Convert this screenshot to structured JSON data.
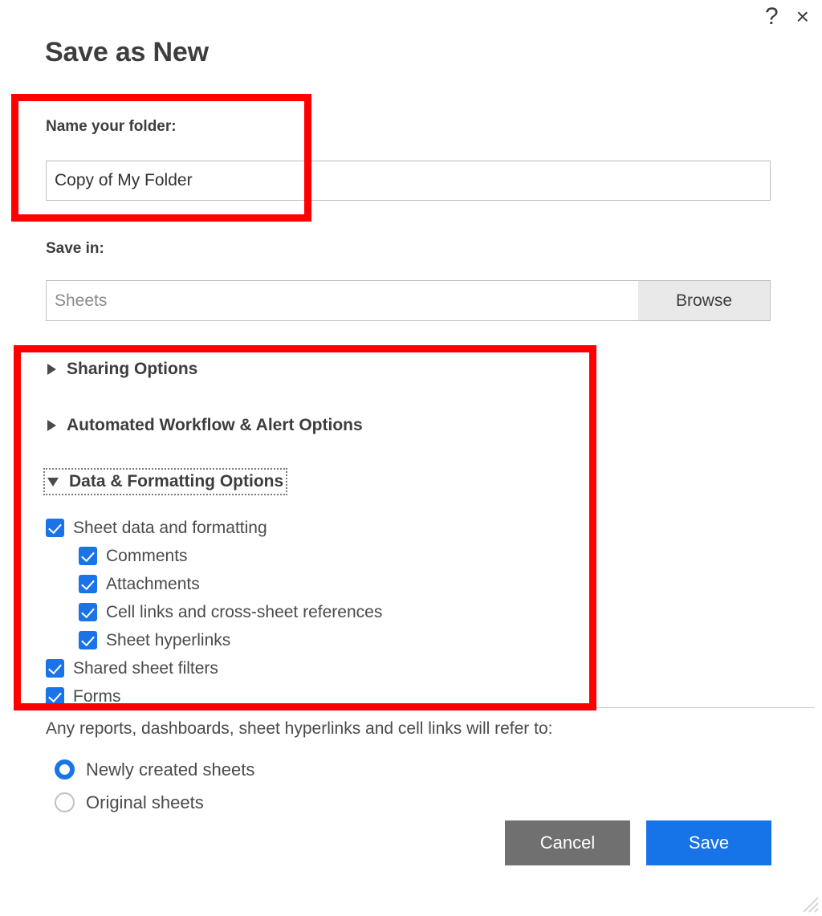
{
  "dialog": {
    "title": "Save as New",
    "help_icon": "?",
    "close_icon": "×"
  },
  "name_field": {
    "label": "Name your folder:",
    "value": "Copy of My Folder",
    "placeholder": ""
  },
  "save_in_field": {
    "label": "Save in:",
    "value": "",
    "placeholder": "Sheets",
    "browse_label": "Browse"
  },
  "sections": [
    {
      "label": "Sharing Options",
      "expanded": false,
      "focused": false
    },
    {
      "label": "Automated Workflow & Alert Options",
      "expanded": false,
      "focused": false
    },
    {
      "label": "Data & Formatting Options",
      "expanded": true,
      "focused": true
    }
  ],
  "checkboxes": [
    {
      "label": "Sheet data and formatting",
      "checked": true,
      "nested": false
    },
    {
      "label": "Comments",
      "checked": true,
      "nested": true
    },
    {
      "label": "Attachments",
      "checked": true,
      "nested": true
    },
    {
      "label": "Cell links and cross-sheet references",
      "checked": true,
      "nested": true
    },
    {
      "label": "Sheet hyperlinks",
      "checked": true,
      "nested": true
    },
    {
      "label": "Shared sheet filters",
      "checked": true,
      "nested": false
    },
    {
      "label": "Forms",
      "checked": true,
      "nested": false
    }
  ],
  "refer_to": {
    "note": "Any reports, dashboards, sheet hyperlinks and cell links will refer to:",
    "options": [
      {
        "label": "Newly created sheets",
        "selected": true
      },
      {
        "label": "Original sheets",
        "selected": false
      }
    ]
  },
  "actions": {
    "cancel_label": "Cancel",
    "save_label": "Save"
  },
  "colors": {
    "accent_blue": "#1a73e8",
    "save_button": "#1673e8",
    "cancel_button": "#707070",
    "annotation_red": "#ff0000",
    "text": "#4a4a4a",
    "placeholder": "#8a8a8a"
  }
}
